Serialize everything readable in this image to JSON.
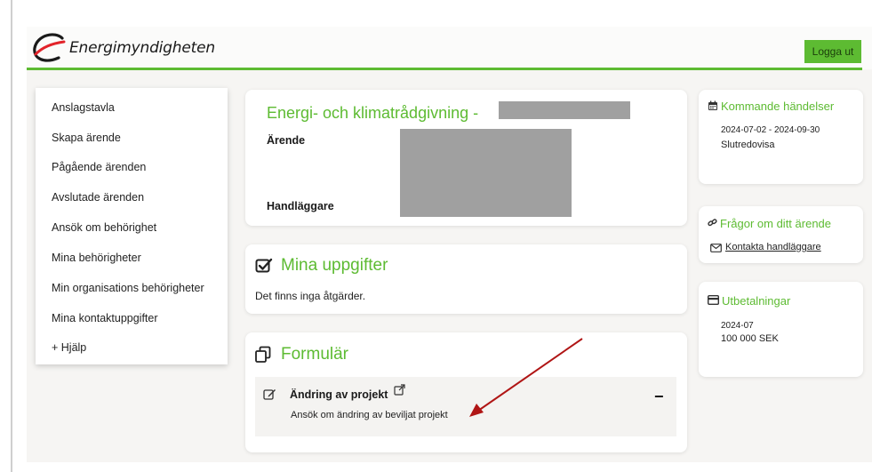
{
  "app": {
    "logo_text": "Energimyndigheten",
    "logout_label": "Logga ut"
  },
  "colors": {
    "brand_green": "#5dbb32",
    "background": "#f6f5f3",
    "redaction_gray": "#a0a0a0"
  },
  "menu": {
    "items": [
      {
        "label": "Anslagstavla"
      },
      {
        "label": "Skapa ärende"
      },
      {
        "label": "Pågående ärenden"
      },
      {
        "label": "Avslutade ärenden"
      },
      {
        "label": "Ansök om behörighet"
      },
      {
        "label": "Mina behörigheter"
      },
      {
        "label": "Min organisations behörigheter"
      },
      {
        "label": "Mina kontaktuppgifter"
      },
      {
        "label": "+ Hjälp"
      }
    ]
  },
  "project": {
    "title": "Energi- och klimatrådgivning -",
    "case_label": "Ärende",
    "officer_label": "Handläggare"
  },
  "tasks": {
    "title": "Mina uppgifter",
    "empty_text": "Det finns inga åtgärder."
  },
  "forms": {
    "title": "Formulär",
    "items": [
      {
        "label": "Ändring av projekt",
        "description": "Ansök om ändring av beviljat projekt",
        "collapse_symbol": "−"
      }
    ]
  },
  "events": {
    "title": "Kommande händelser",
    "date_range": "2024-07-02 - 2024-09-30",
    "event_name": "Slutredovisa"
  },
  "questions": {
    "title": "Frågor om ditt ärende",
    "contact_link": "Kontakta handläggare"
  },
  "payments": {
    "title": "Utbetalningar",
    "period": "2024-07",
    "amount": "100 000 SEK"
  },
  "icons": {
    "calendar": "calendar-icon",
    "link": "link-icon",
    "envelope": "envelope-icon",
    "credit_card": "credit-card-icon",
    "checkbox": "checkbox-icon",
    "copy": "copy-icon",
    "edit": "edit-icon",
    "external_link": "external-link-icon"
  }
}
